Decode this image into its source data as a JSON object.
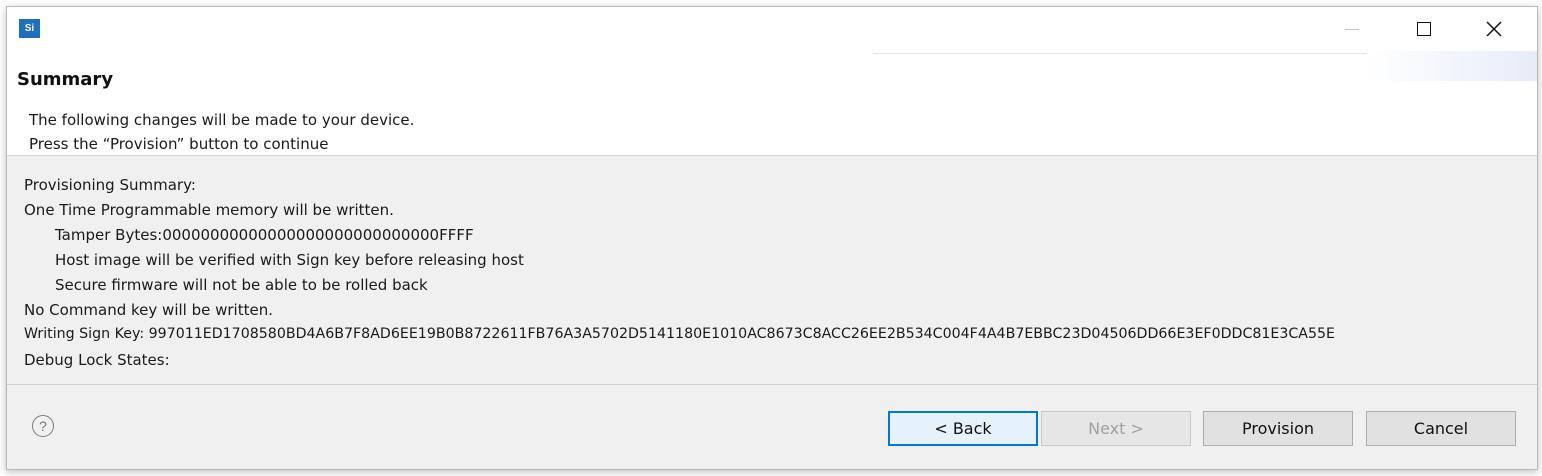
{
  "window": {
    "app_icon_text": "Si"
  },
  "header": {
    "title": "Summary",
    "description_line1": "The following changes will be made to your device.",
    "description_line2": "Press the “Provision” button to continue"
  },
  "content": {
    "lines": [
      "Provisioning Summary:",
      "One Time Programmable memory will be written.",
      "Tamper Bytes:00000000000000000000000000000FFFF",
      "Host image will be verified with Sign key before releasing host",
      "Secure firmware will not be able to be rolled back",
      "No Command key will be written.",
      "Writing Sign Key: 997011ED1708580BD4A6B7F8AD6EE19B0B8722611FB76A3A5702D5141180E1010AC8673C8ACC26EE2B534C004F4A4B7EBBC23D04506DD66E3EF0DDC81E3CA55E",
      "Debug Lock States:"
    ]
  },
  "footer": {
    "help_symbol": "?",
    "back_label": "< Back",
    "next_label": "Next >",
    "provision_label": "Provision",
    "cancel_label": "Cancel"
  },
  "icons": {
    "minimize": "minimize-icon",
    "maximize": "maximize-icon",
    "close": "close-icon",
    "help": "help-icon",
    "app": "app-icon"
  },
  "colors": {
    "accent": "#0078d7",
    "app_icon": "#1f6fbf"
  }
}
